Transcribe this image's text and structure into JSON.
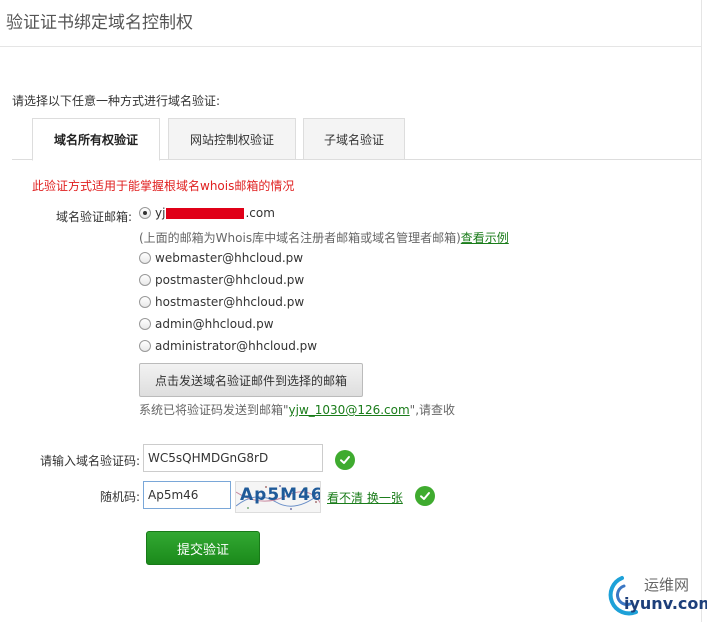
{
  "page": {
    "title": "验证证书绑定域名控制权"
  },
  "instruction": "请选择以下任意一种方式进行域名验证:",
  "tabs": [
    {
      "label": "域名所有权验证",
      "active": true
    },
    {
      "label": "网站控制权验证",
      "active": false
    },
    {
      "label": "子域名验证",
      "active": false
    }
  ],
  "note": "此验证方式适用于能掌握根域名whois邮箱的情况",
  "email_section": {
    "label": "域名验证邮箱:",
    "options": [
      {
        "prefix": "yj",
        "suffix": ".com",
        "checked": true
      },
      {
        "text": "webmaster@hhcloud.pw",
        "checked": false
      },
      {
        "text": "postmaster@hhcloud.pw",
        "checked": false
      },
      {
        "text": "hostmaster@hhcloud.pw",
        "checked": false
      },
      {
        "text": "admin@hhcloud.pw",
        "checked": false
      },
      {
        "text": "administrator@hhcloud.pw",
        "checked": false
      }
    ],
    "hint": "(上面的邮箱为Whois库中域名注册者邮箱或域名管理者邮箱)",
    "hint_link": "查看示例",
    "send_button": "点击发送域名验证邮件到选择的邮箱",
    "sent_prefix": "系统已将验证码发送到邮箱\"",
    "sent_address": "yjw_1030@126.com",
    "sent_suffix": "\",请查收"
  },
  "code_field": {
    "label": "请输入域名验证码:",
    "value": "WC5sQHMDGnG8rD"
  },
  "captcha_field": {
    "label": "随机码:",
    "value": "Ap5m46",
    "image_text": "Ap5M46",
    "refresh": "看不清 换一张"
  },
  "submit_button": "提交验证",
  "watermark": {
    "cn": "运维网",
    "en": "iyunv.com"
  },
  "colors": {
    "accent_green": "#1b8a1b",
    "note_red": "#e02020",
    "check_green": "#3fab2f",
    "redaction": "#e00018"
  }
}
